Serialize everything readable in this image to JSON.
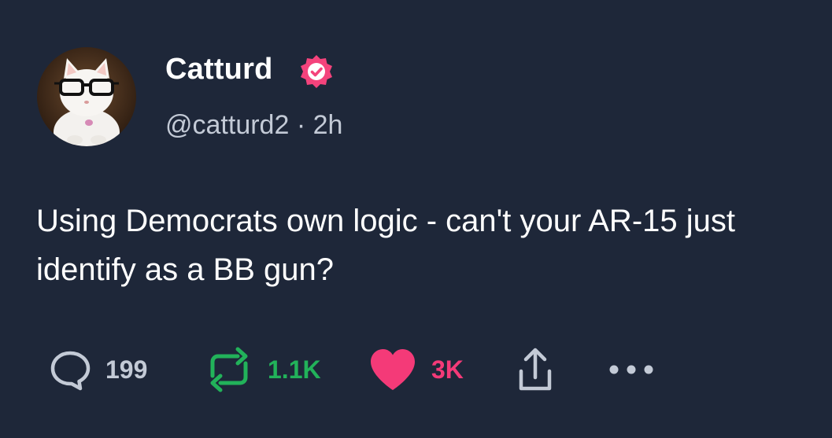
{
  "tweet": {
    "author": {
      "display_name": "Catturd",
      "handle": "@catturd2",
      "time_ago": "2h",
      "separator": "·",
      "verified": true
    },
    "text": "Using Democrats own logic - can't your AR-15 just identify as a BB gun?",
    "actions": {
      "replies": "199",
      "retweets": "1.1K",
      "likes": "3K"
    },
    "colors": {
      "background": "#1e2739",
      "reply": "#c3cad6",
      "retweet": "#22b25a",
      "like": "#f43a78",
      "verified_badge": "#f4437c"
    },
    "icons": {
      "reply": "speech-bubble-icon",
      "retweet": "retweet-icon",
      "like": "heart-icon",
      "share": "share-icon",
      "more": "more-dots-icon",
      "verified": "verified-check-icon"
    }
  }
}
